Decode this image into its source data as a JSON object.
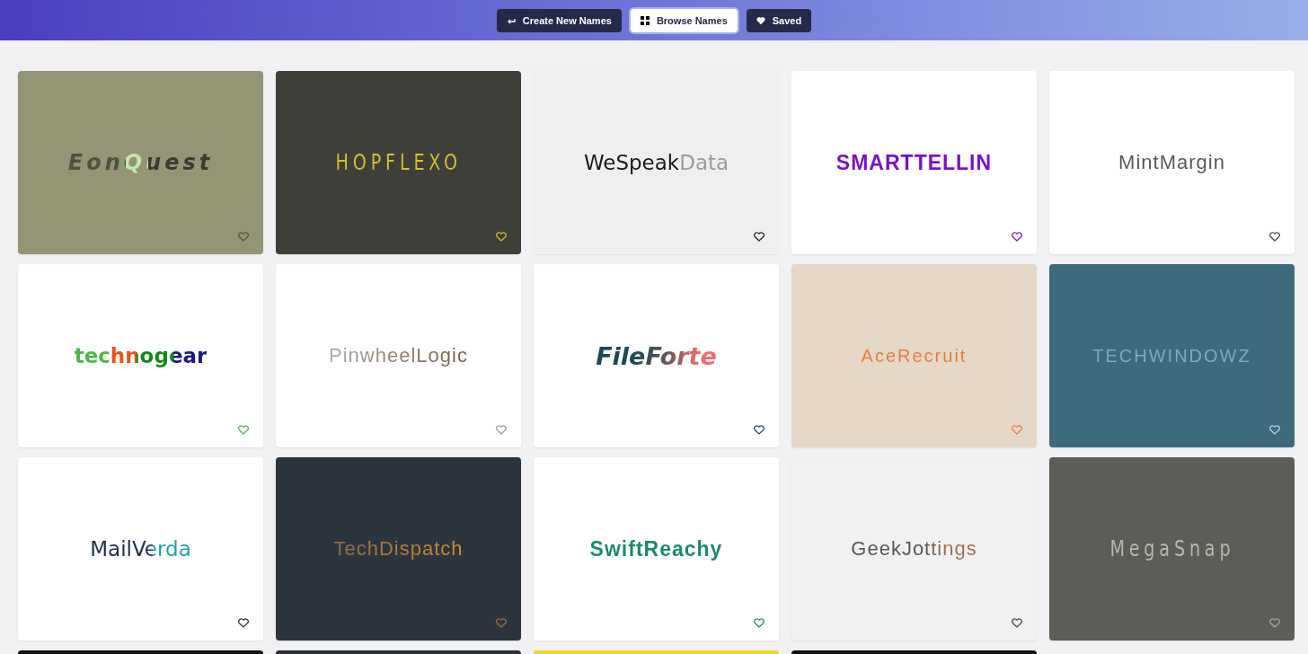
{
  "nav": [
    {
      "label": "Create New Names",
      "selected": false
    },
    {
      "label": "Browse Names",
      "selected": true
    },
    {
      "label": "Saved",
      "selected": false
    }
  ],
  "cards": [
    {
      "kind": "logo",
      "name": "EonQuest"
    },
    {
      "kind": "logo",
      "name": "HOPFLEXO"
    },
    {
      "kind": "logo",
      "name": "WeSpeakData"
    },
    {
      "kind": "logo",
      "name": "SMARTTELLIN"
    },
    {
      "kind": "logo",
      "name": "MintMargin"
    },
    {
      "kind": "logo",
      "name": "technogear"
    },
    {
      "kind": "logo",
      "name": "PinwheelLogic"
    },
    {
      "kind": "logo",
      "name": "FileForte"
    },
    {
      "kind": "logo",
      "name": "AceRecruit"
    },
    {
      "kind": "logo",
      "name": "TECHWINDOWZ"
    },
    {
      "kind": "logo",
      "name": "MailVerda"
    },
    {
      "kind": "logo",
      "name": "TechDispatch"
    },
    {
      "kind": "logo",
      "name": "SwiftReachy"
    },
    {
      "kind": "logo",
      "name": "GeekJottings"
    },
    {
      "kind": "logo",
      "name": "MegaSnap"
    },
    {
      "kind": "partial"
    },
    {
      "kind": "partial"
    },
    {
      "kind": "partial"
    },
    {
      "kind": "partial"
    },
    {
      "kind": "partial"
    }
  ]
}
